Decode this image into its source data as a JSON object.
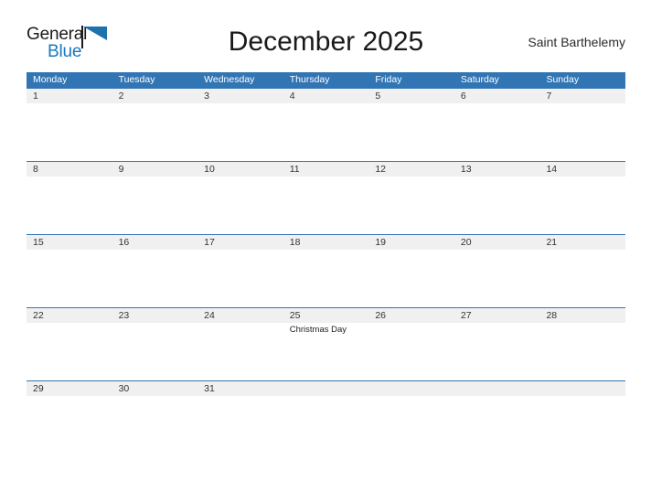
{
  "brand": {
    "name_top": "General",
    "name_bottom": "Blue",
    "accent_color": "#1878be",
    "flag_color": "#1b72ad"
  },
  "header": {
    "title": "December 2025",
    "region": "Saint Barthelemy"
  },
  "theme": {
    "header_blue": "#3275b4",
    "band_gray": "#f0f0f0",
    "text_dark": "#333333"
  },
  "calendar": {
    "weekday_headers": [
      "Monday",
      "Tuesday",
      "Wednesday",
      "Thursday",
      "Friday",
      "Saturday",
      "Sunday"
    ],
    "weeks": [
      {
        "days": [
          {
            "num": "1",
            "events": []
          },
          {
            "num": "2",
            "events": []
          },
          {
            "num": "3",
            "events": []
          },
          {
            "num": "4",
            "events": []
          },
          {
            "num": "5",
            "events": []
          },
          {
            "num": "6",
            "events": []
          },
          {
            "num": "7",
            "events": []
          }
        ]
      },
      {
        "days": [
          {
            "num": "8",
            "events": []
          },
          {
            "num": "9",
            "events": []
          },
          {
            "num": "10",
            "events": []
          },
          {
            "num": "11",
            "events": []
          },
          {
            "num": "12",
            "events": []
          },
          {
            "num": "13",
            "events": []
          },
          {
            "num": "14",
            "events": []
          }
        ]
      },
      {
        "days": [
          {
            "num": "15",
            "events": []
          },
          {
            "num": "16",
            "events": []
          },
          {
            "num": "17",
            "events": []
          },
          {
            "num": "18",
            "events": []
          },
          {
            "num": "19",
            "events": []
          },
          {
            "num": "20",
            "events": []
          },
          {
            "num": "21",
            "events": []
          }
        ]
      },
      {
        "days": [
          {
            "num": "22",
            "events": []
          },
          {
            "num": "23",
            "events": []
          },
          {
            "num": "24",
            "events": []
          },
          {
            "num": "25",
            "events": [
              "Christmas Day"
            ]
          },
          {
            "num": "26",
            "events": []
          },
          {
            "num": "27",
            "events": []
          },
          {
            "num": "28",
            "events": []
          }
        ]
      },
      {
        "days": [
          {
            "num": "29",
            "events": []
          },
          {
            "num": "30",
            "events": []
          },
          {
            "num": "31",
            "events": []
          },
          {
            "num": "",
            "events": []
          },
          {
            "num": "",
            "events": []
          },
          {
            "num": "",
            "events": []
          },
          {
            "num": "",
            "events": []
          }
        ]
      }
    ]
  }
}
